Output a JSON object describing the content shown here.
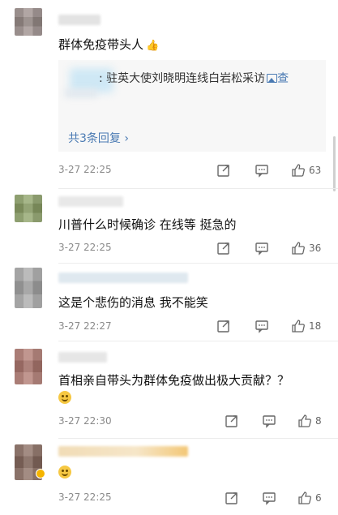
{
  "comments": [
    {
      "text": "群体免疫带头人",
      "time": "3-27 22:25",
      "likes": "63",
      "thumb_glyph": "👍",
      "replies": {
        "preview_text": ": 驻英大使刘晓明连线白岩松采访",
        "preview_link": "查",
        "more_label": "共3条回复 ›"
      },
      "avatar_color": "#9c8f8c",
      "username_color": "#e3e3e3"
    },
    {
      "text": "川普什么时候确诊 在线等 挺急的",
      "time": "3-27 22:25",
      "likes": "36",
      "avatar_color": "#8fa36a",
      "username_color": "#e8e8e8"
    },
    {
      "text": "这是个悲伤的消息 我不能笑",
      "time": "3-27 22:27",
      "likes": "18",
      "avatar_color": "#a9a9a9",
      "username_color": "#dfe8ef"
    },
    {
      "text": "首相亲自带头为群体免疫做出极大贡献？？",
      "time": "3-27 22:30",
      "likes": "8",
      "avatar_color": "#b07a72",
      "username_color": "#e6e6e6"
    },
    {
      "text": "",
      "time": "3-27 22:25",
      "likes": "6",
      "avatar_color": "#8a6d62",
      "username_color": "#f1dcb6"
    }
  ],
  "icons": {
    "repost": "repost-icon",
    "comment": "comment-icon",
    "like": "like-icon",
    "emoji": "grin-emoji-icon",
    "picture": "picture-icon",
    "verified": "verified-badge-icon"
  },
  "colors": {
    "link": "#4a7ab3",
    "meta": "#8a8a8a",
    "text": "#111111"
  }
}
